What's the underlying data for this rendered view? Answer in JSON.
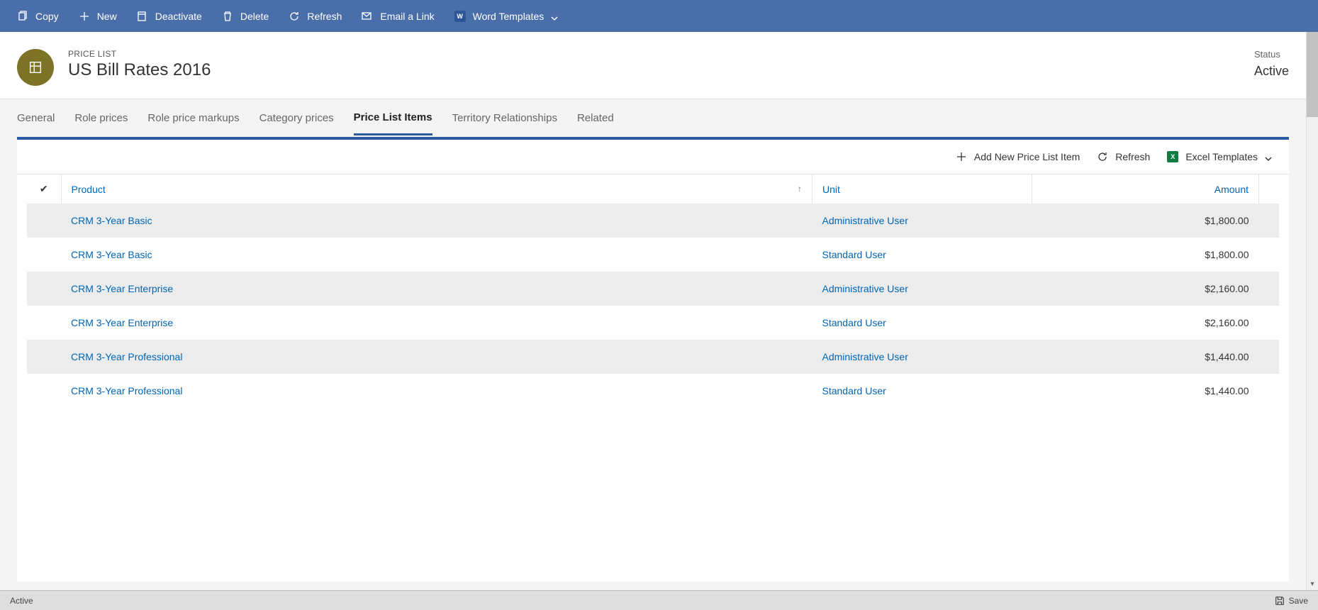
{
  "commandbar": {
    "copy": "Copy",
    "new": "New",
    "deactivate": "Deactivate",
    "delete": "Delete",
    "refresh": "Refresh",
    "email_link": "Email a Link",
    "word_templates": "Word Templates"
  },
  "header": {
    "entity_label": "PRICE LIST",
    "title": "US Bill Rates 2016",
    "status_label": "Status",
    "status_value": "Active"
  },
  "tabs": {
    "general": "General",
    "role_prices": "Role prices",
    "role_price_markups": "Role price markups",
    "category_prices": "Category prices",
    "price_list_items": "Price List Items",
    "territory_relationships": "Territory Relationships",
    "related": "Related"
  },
  "grid_commands": {
    "add_new": "Add New Price List Item",
    "refresh": "Refresh",
    "excel_templates": "Excel Templates"
  },
  "columns": {
    "product": "Product",
    "unit": "Unit",
    "amount": "Amount"
  },
  "rows": [
    {
      "product": "CRM 3-Year Basic",
      "unit": "Administrative User",
      "amount": "$1,800.00"
    },
    {
      "product": "CRM 3-Year Basic",
      "unit": "Standard User",
      "amount": "$1,800.00"
    },
    {
      "product": "CRM 3-Year Enterprise",
      "unit": "Administrative User",
      "amount": "$2,160.00"
    },
    {
      "product": "CRM 3-Year Enterprise",
      "unit": "Standard User",
      "amount": "$2,160.00"
    },
    {
      "product": "CRM 3-Year Professional",
      "unit": "Administrative User",
      "amount": "$1,440.00"
    },
    {
      "product": "CRM 3-Year Professional",
      "unit": "Standard User",
      "amount": "$1,440.00"
    }
  ],
  "footer": {
    "status": "Active",
    "save": "Save"
  }
}
